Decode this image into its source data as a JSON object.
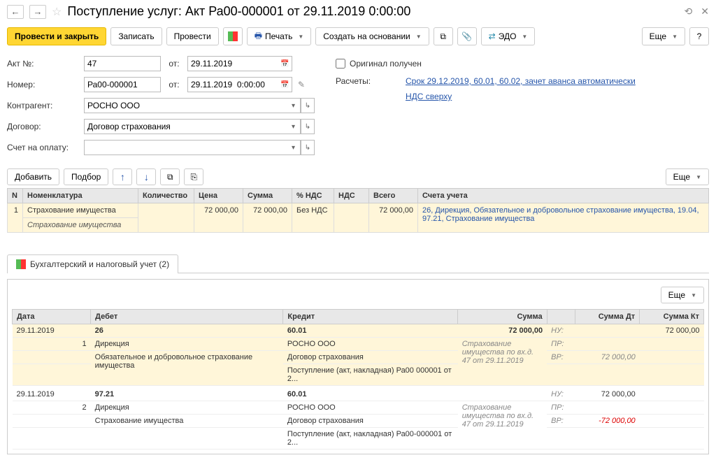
{
  "title": "Поступление услуг: Акт Ра00-000001 от 29.11.2019 0:00:00",
  "toolbar": {
    "post_close": "Провести и закрыть",
    "save": "Записать",
    "post": "Провести",
    "print": "Печать",
    "create_based": "Создать на основании",
    "edo": "ЭДО",
    "more": "Еще"
  },
  "form": {
    "akt_label": "Акт №:",
    "akt_value": "47",
    "ot_label": "от:",
    "akt_date": "29.11.2019",
    "number_label": "Номер:",
    "number_value": "Ра00-000001",
    "number_date": "29.11.2019  0:00:00",
    "counterparty_label": "Контрагент:",
    "counterparty_value": "РОСНО ООО",
    "contract_label": "Договор:",
    "contract_value": "Договор страхования",
    "invoice_label": "Счет на оплату:",
    "invoice_value": "",
    "original_received": "Оригинал получен",
    "calculations_label": "Расчеты:",
    "calculations_link": "Срок 29.12.2019, 60.01, 60.02, зачет аванса автоматически",
    "vat_link": "НДС сверху"
  },
  "table_toolbar": {
    "add": "Добавить",
    "pick": "Подбор",
    "more": "Еще"
  },
  "table_headers": {
    "n": "N",
    "nomenclature": "Номенклатура",
    "qty": "Количество",
    "price": "Цена",
    "sum": "Сумма",
    "vat_pct": "% НДС",
    "vat": "НДС",
    "total": "Всего",
    "accounts": "Счета учета"
  },
  "table_rows": [
    {
      "n": "1",
      "nomenclature": "Страхование имущества",
      "nomenclature2": "Страхование имущества",
      "qty": "",
      "price": "72 000,00",
      "sum": "72 000,00",
      "vat_pct": "Без НДС",
      "vat": "",
      "total": "72 000,00",
      "accounts": "26, Дирекция, Обязательное и добровольное страхование имущества, 19.04, 97.21, Страхование имущества"
    }
  ],
  "tab_label": "Бухгалтерский и налоговый учет (2)",
  "reg_headers": {
    "date": "Дата",
    "debit": "Дебет",
    "credit": "Кредит",
    "sum": "Сумма",
    "sum_dt": "Сумма Дт",
    "sum_kt": "Сумма Кт"
  },
  "reg_rows": {
    "r1": {
      "date": "29.11.2019",
      "n": "1",
      "d1": "26",
      "d2": "Дирекция",
      "d3": "Обязательное и добровольное страхование имущества",
      "k1": "60.01",
      "k2": "РОСНО ООО",
      "k3": "Договор страхования",
      "k4": "Поступление (акт, накладная) Ра00 000001 от 2...",
      "sum": "72 000,00",
      "desc1": "Страхование",
      "desc2": "имущества по вх.д.",
      "desc3": "47 от 29.11.2019",
      "nu_label": "НУ:",
      "pr_label": "ПР:",
      "vr_label": "ВР:",
      "sum_kt": "72 000,00",
      "sum_dt_vr": "72 000,00"
    },
    "r2": {
      "date": "29.11.2019",
      "n": "2",
      "d1": "97.21",
      "d2": "Дирекция",
      "d3": "Страхование имущества",
      "k1": "60.01",
      "k2": "РОСНО ООО",
      "k3": "Договор страхования",
      "k4": "Поступление (акт, накладная) Ра00-000001 от 2...",
      "desc1": "Страхование",
      "desc2": "имущества по вх.д.",
      "desc3": "47 от 29.11.2019",
      "nu_label": "НУ:",
      "pr_label": "ПР:",
      "vr_label": "ВР:",
      "sum_dt_nu": "72 000,00",
      "sum_dt_vr": "-72 000,00"
    }
  }
}
